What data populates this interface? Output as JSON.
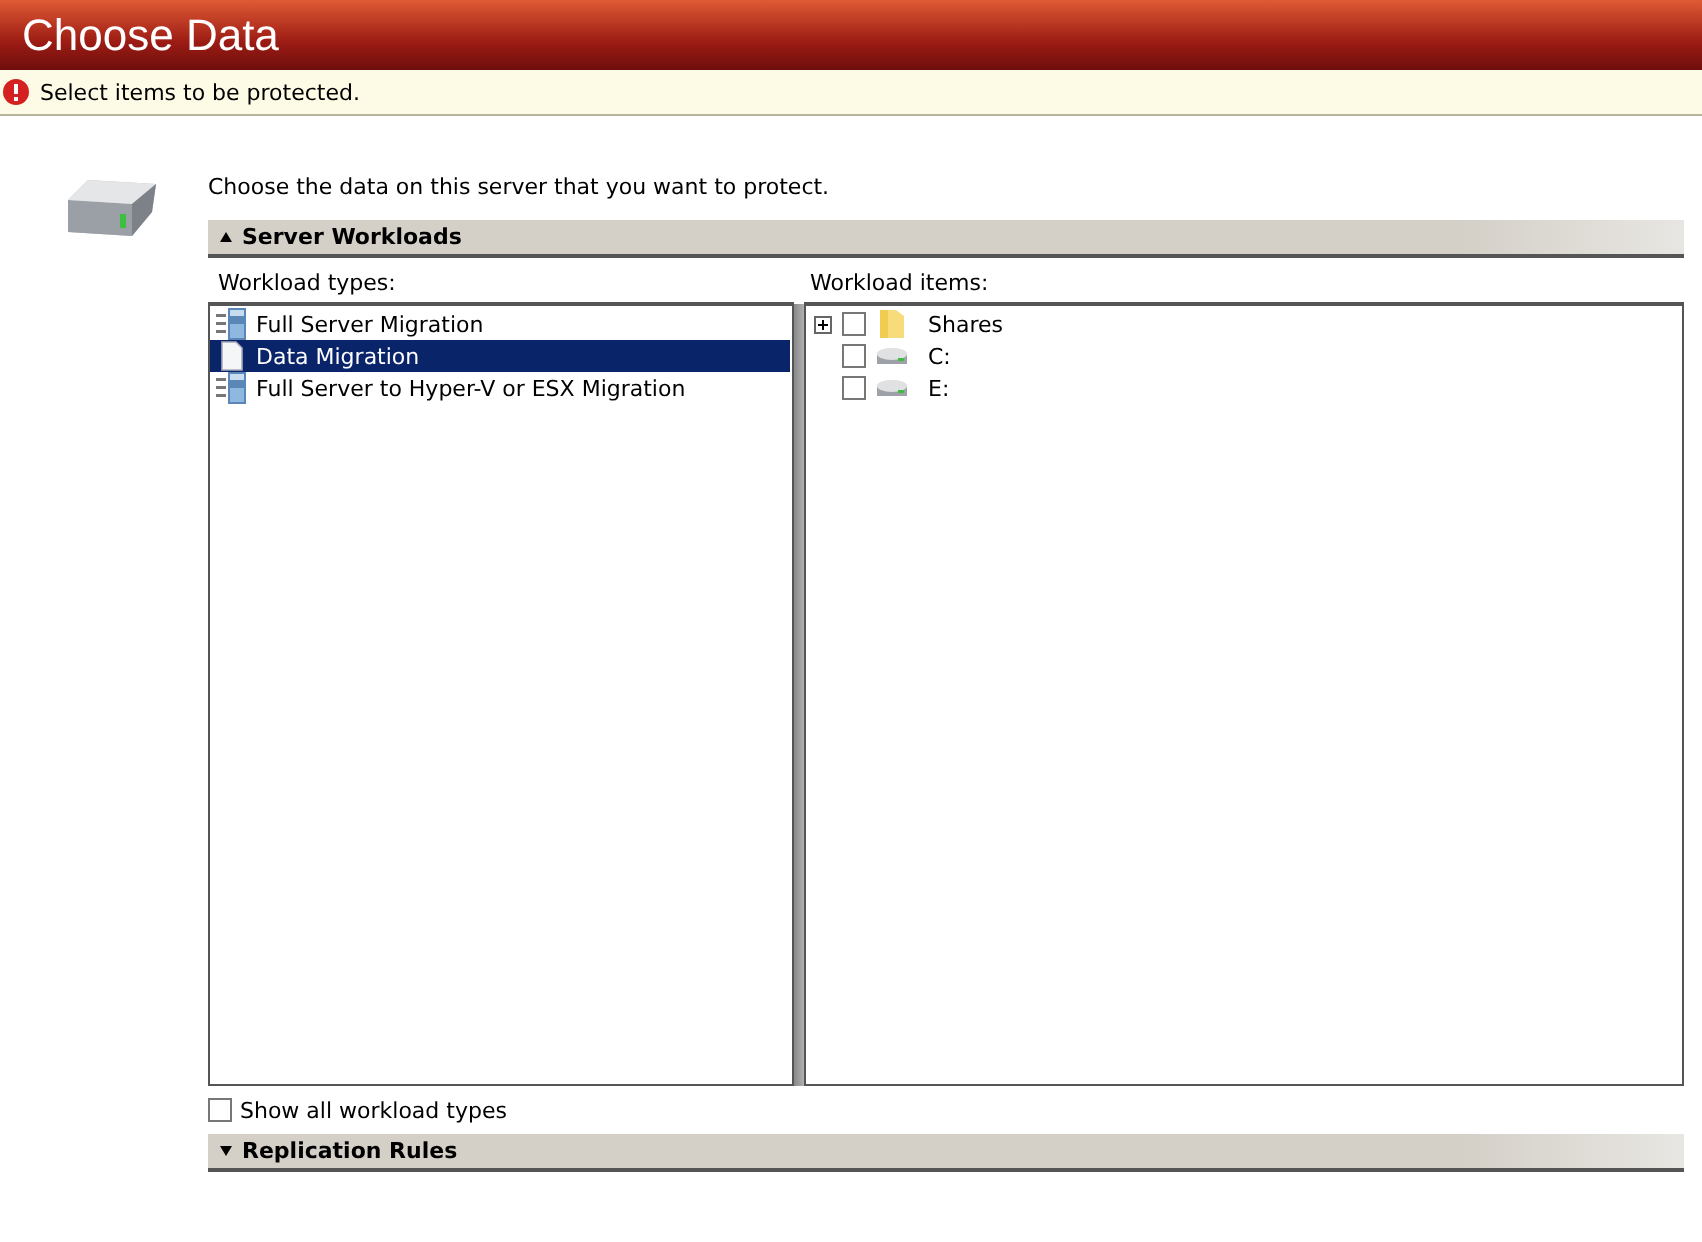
{
  "header": {
    "title": "Choose Data"
  },
  "alert": {
    "kind": "error",
    "message": "Select items to be protected."
  },
  "intro": "Choose the data on this server that you want to protect.",
  "sections": [
    {
      "title": "Server Workloads",
      "expanded": true,
      "workload_types": {
        "label": "Workload types:",
        "items": [
          {
            "label": "Full Server Migration",
            "kind": "server",
            "selected": false
          },
          {
            "label": "Data Migration",
            "kind": "data",
            "selected": true
          },
          {
            "label": "Full Server to Hyper-V or ESX Migration",
            "kind": "server",
            "selected": false
          }
        ]
      },
      "workload_items": {
        "label": "Workload items:",
        "items": [
          {
            "label": "Shares",
            "kind": "folder",
            "checked": false,
            "expandable": true,
            "expanded": false
          },
          {
            "label": "C:",
            "kind": "drive",
            "checked": false,
            "expandable": false
          },
          {
            "label": "E:",
            "kind": "drive",
            "checked": false,
            "expandable": false
          }
        ]
      },
      "show_all": {
        "label": "Show all workload types",
        "checked": false
      }
    },
    {
      "title": "Replication Rules",
      "expanded": false
    }
  ]
}
